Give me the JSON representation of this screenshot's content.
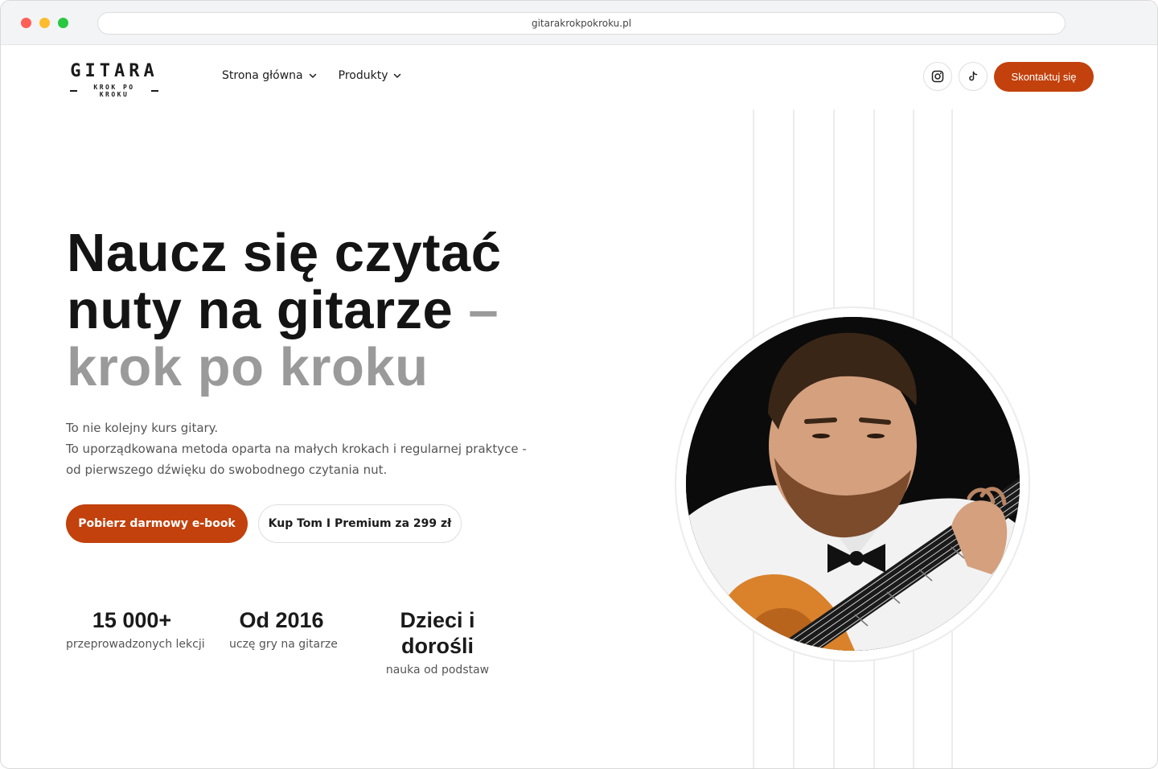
{
  "browser": {
    "url": "gitarakrokpokroku.pl"
  },
  "header": {
    "logo_word": "GITARA",
    "logo_sub": "KROK PO KROKU",
    "nav": [
      {
        "label": "Strona główna"
      },
      {
        "label": "Produkty"
      }
    ],
    "contact_label": "Skontaktuj się"
  },
  "hero": {
    "title_line1": "Naucz się czytać",
    "title_line2": "nuty na gitarze",
    "title_dash": "–",
    "title_line3": "krok po kroku",
    "desc_line1": "To nie kolejny kurs gitary.",
    "desc_line2": "To uporządkowana metoda oparta na małych krokach i regularnej praktyce -",
    "desc_line3": "od pierwszego dźwięku do swobodnego czytania nut.",
    "cta_primary": "Pobierz darmowy e-book",
    "cta_secondary": "Kup Tom I Premium za 299 zł"
  },
  "stats": [
    {
      "value": "15 000+",
      "label": "przeprowadzonych lekcji"
    },
    {
      "value": "Od 2016",
      "label": "uczę gry na gitarze"
    },
    {
      "value": "Dzieci i dorośli",
      "label": "nauka od podstaw"
    }
  ],
  "colors": {
    "accent": "#c2410c",
    "title_muted": "#9a9a9a"
  },
  "icons": [
    "instagram-icon",
    "tiktok-icon",
    "chevron-down-icon"
  ]
}
